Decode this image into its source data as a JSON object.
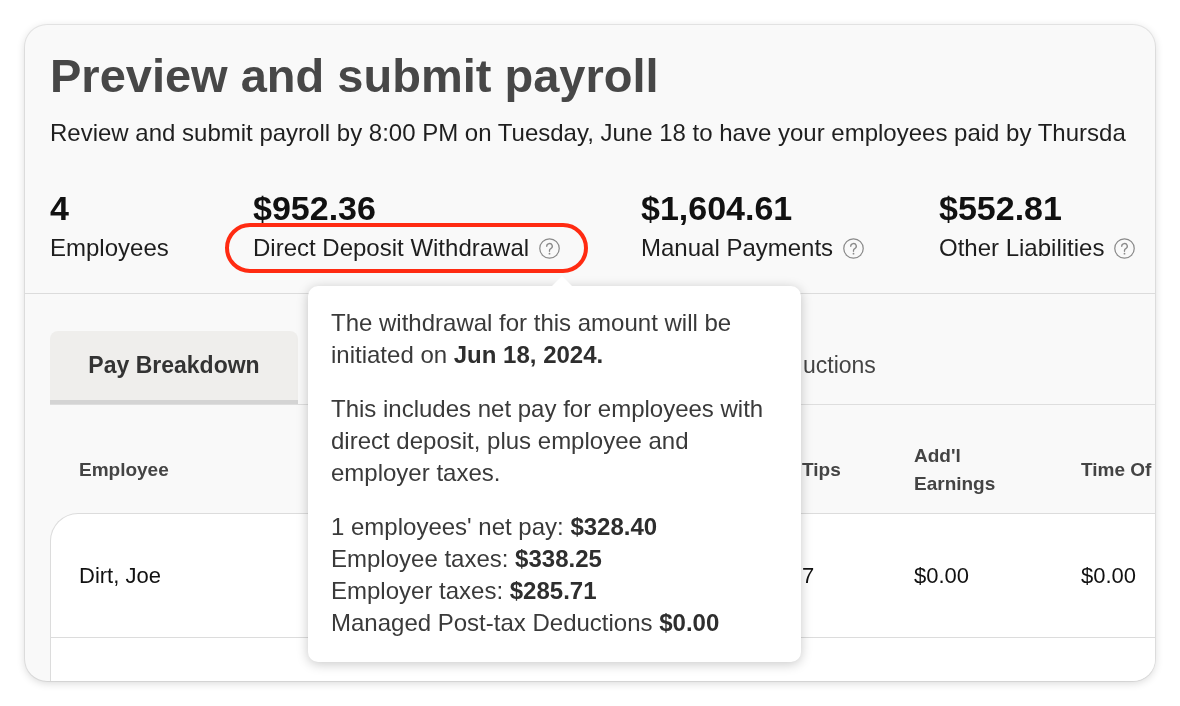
{
  "page": {
    "title": "Preview and submit payroll",
    "subtitle": "Review and submit payroll by 8:00 PM on Tuesday, June 18 to have your employees paid by Thursda"
  },
  "stats": [
    {
      "value": "4",
      "label": "Employees",
      "help": false,
      "highlighted": false
    },
    {
      "value": "$952.36",
      "label": "Direct Deposit Withdrawal",
      "help": true,
      "highlighted": true
    },
    {
      "value": "$1,604.61",
      "label": "Manual Payments",
      "help": true,
      "highlighted": false
    },
    {
      "value": "$552.81",
      "label": "Other Liabilities",
      "help": true,
      "highlighted": false
    }
  ],
  "tabs": [
    {
      "label": "Pay Breakdown",
      "selected": true
    },
    {
      "label": "uctions",
      "selected": false
    }
  ],
  "table": {
    "columns": [
      "Employee",
      "Tips",
      "Add'l Earnings",
      "Time Of"
    ],
    "rows": [
      {
        "cells": [
          "Dirt, Joe",
          "7",
          "$0.00",
          "$0.00"
        ]
      }
    ]
  },
  "tooltip": {
    "paragraphs": [
      "The withdrawal for this amount will be initiated on **Jun 18, 2024.**",
      "This includes net pay for employees with direct deposit, plus employee and employer taxes."
    ],
    "breakdown": [
      "1 employees' net pay: **$328.40**",
      "Employee taxes: **$338.25**",
      "Employer taxes: **$285.71**",
      "Managed Post-tax Deductions **$0.00**"
    ]
  }
}
